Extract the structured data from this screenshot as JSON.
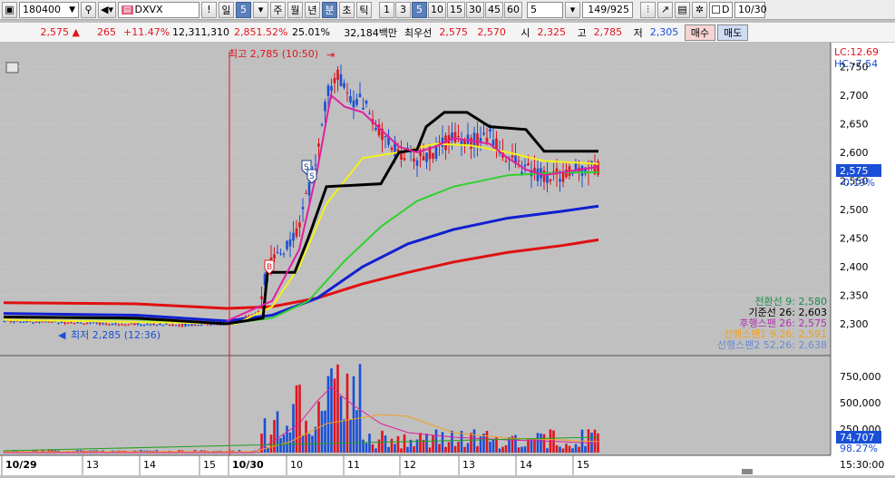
{
  "toolbar": {
    "code": "180400",
    "stock_name": "DXVX",
    "exclaim": "!",
    "period_day": "일",
    "period_value": "5",
    "week": "주",
    "month": "월",
    "year": "년",
    "minute": "분",
    "second": "초",
    "tick": "틱",
    "intervals": [
      "1",
      "3",
      "5",
      "10",
      "15",
      "30",
      "45",
      "60"
    ],
    "active_interval": "5",
    "count_value": "5",
    "page_counter": "149/925",
    "date_checkbox": "D",
    "date_value": "10/30"
  },
  "ticker": {
    "price": "2,575",
    "change": "265",
    "change_pct": "+11.47%",
    "volume": "12,311,310",
    "vol_ratio": "2,851.52%",
    "turnover": "25.01%",
    "amount": "32,184백만",
    "best_label": "최우선",
    "ask": "2,575",
    "bid": "2,570",
    "open_label": "시",
    "open": "2,325",
    "high_label": "고",
    "high": "2,785",
    "low_label": "저",
    "low": "2,305",
    "buy_button": "매수",
    "sell_button": "매도"
  },
  "chart": {
    "lc_label": "LC:12.69",
    "hc_label": "HC:-7.54",
    "price_ticks": [
      "2,750",
      "2,700",
      "2,650",
      "2,600",
      "2,550",
      "2,500",
      "2,450",
      "2,400",
      "2,350",
      "2,300"
    ],
    "current_price": "2,575",
    "current_pct": "-0.19%",
    "high_marker": "최고 2,785 (10:50)",
    "low_marker": "최저 2,285 (12:36)",
    "buy_badge": "B",
    "sell_badge": "S",
    "legend": [
      {
        "text": "전환선 9: 2,580",
        "color": "#1f8a4c"
      },
      {
        "text": "기준선 26: 2,603",
        "color": "#000000"
      },
      {
        "text": "후행스팬 26: 2,575",
        "color": "#b030b0"
      },
      {
        "text": "선행스팬1 9,26: 2,591",
        "color": "#f0a020"
      },
      {
        "text": "선행스팬2 52,26: 2,638",
        "color": "#6a8ad0"
      }
    ],
    "volume_ticks": [
      "750,000",
      "500,000",
      "250,000"
    ],
    "current_volume": "74,707",
    "volume_pct": "98.27%",
    "x_labels": [
      {
        "text": "10/29",
        "bold": true
      },
      {
        "text": "13",
        "bold": false
      },
      {
        "text": "14",
        "bold": false
      },
      {
        "text": "15",
        "bold": false
      },
      {
        "text": "10/30",
        "bold": true
      },
      {
        "text": "10",
        "bold": false
      },
      {
        "text": "11",
        "bold": false
      },
      {
        "text": "12",
        "bold": false
      },
      {
        "text": "13",
        "bold": false
      },
      {
        "text": "14",
        "bold": false
      },
      {
        "text": "15",
        "bold": false
      }
    ],
    "time_label": "15:30:00"
  },
  "colors": {
    "up": "#e0141e",
    "down": "#1a4fd6",
    "ma5": "#e020a0",
    "ma20": "#f2f21a",
    "ma60": "#30d030",
    "ma120": "#1020d0",
    "ma240": "#e01010",
    "kijun": "#000000"
  }
}
